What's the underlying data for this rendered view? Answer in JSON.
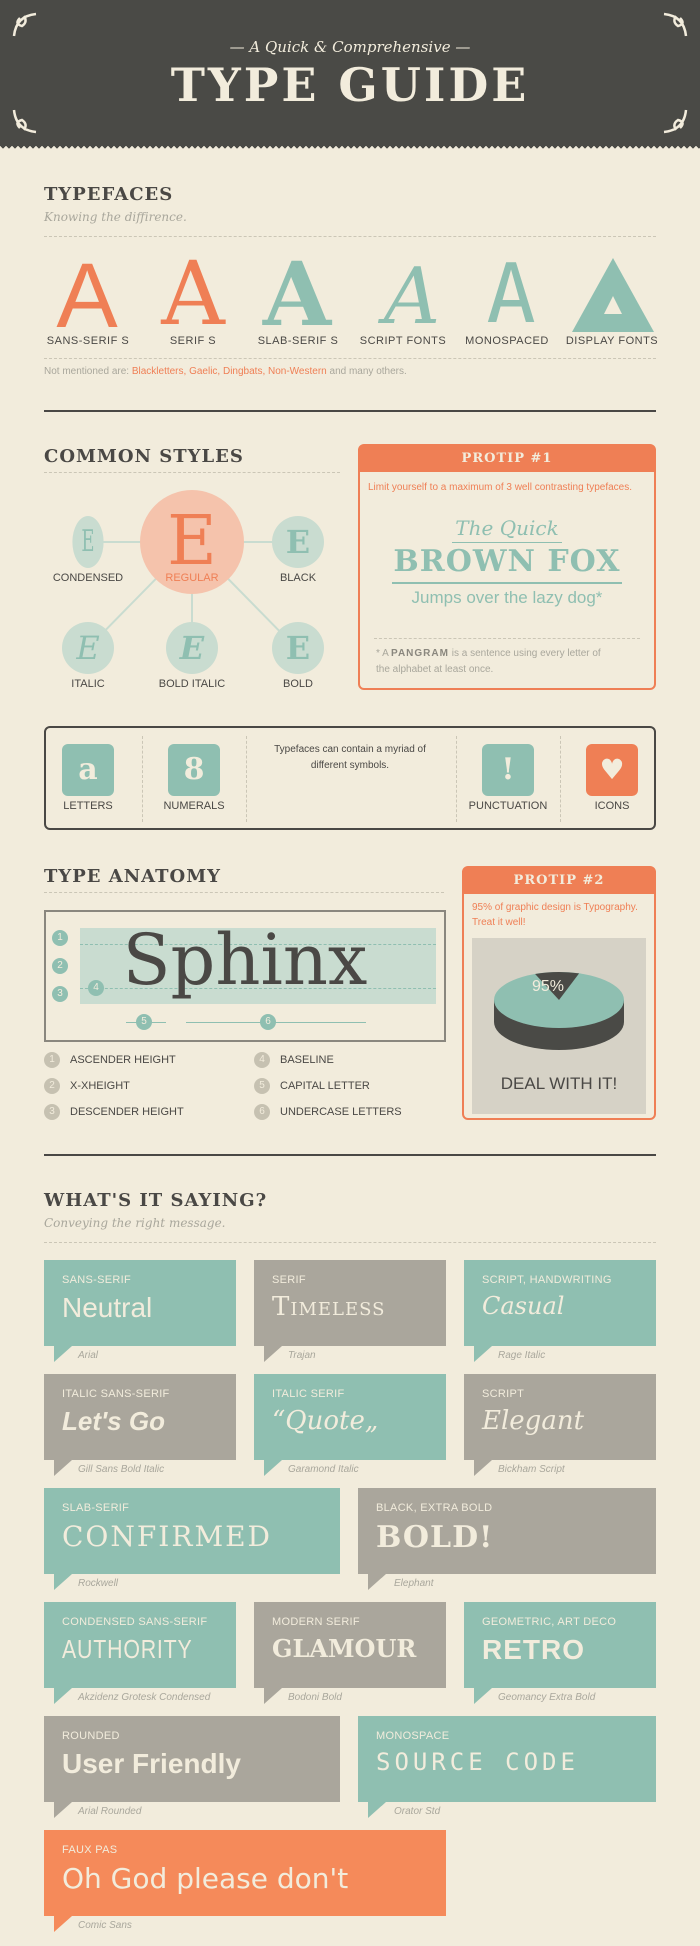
{
  "header": {
    "subtitle": "— A Quick & Comprehensive —",
    "title": "TYPE GUIDE"
  },
  "typefaces": {
    "title": "TYPEFACES",
    "subtitle": "Knowing the diffirence.",
    "items": [
      {
        "glyph": "A",
        "label": "SANS-SERIF S"
      },
      {
        "glyph": "A",
        "label": "SERIF S"
      },
      {
        "glyph": "A",
        "label": "SLAB-SERIF S"
      },
      {
        "glyph": "A",
        "label": "SCRIPT FONTS"
      },
      {
        "glyph": "A",
        "label": "MONOSPACED"
      },
      {
        "glyph": "A",
        "label": "DISPLAY FONTS"
      }
    ],
    "note_prefix": "Not mentioned are: ",
    "note_links": "Blackletters, Gaelic, Dingbats, Non-Western",
    "note_suffix": " and many others."
  },
  "styles": {
    "title": "COMMON STYLES",
    "items": [
      {
        "glyph": "E",
        "label": "CONDENSED"
      },
      {
        "glyph": "E",
        "label": "REGULAR"
      },
      {
        "glyph": "E",
        "label": "BLACK"
      },
      {
        "glyph": "E",
        "label": "ITALIC"
      },
      {
        "glyph": "E",
        "label": "BOLD ITALIC"
      },
      {
        "glyph": "E",
        "label": "BOLD"
      }
    ]
  },
  "protip1": {
    "head": "PROTIP #1",
    "text": "Limit yourself to a maximum of 3 well contrasting typefaces.",
    "line1": "The Quick",
    "line2": "BROWN FOX",
    "line3": "Jumps over the lazy dog*",
    "foot_prefix": "* A ",
    "foot_bold": "PANGRAM",
    "foot_rest": " is a sentence using every letter of",
    "foot_line2": "the alphabet at least once."
  },
  "symbols": {
    "items": [
      {
        "glyph": "a",
        "label": "LETTERS"
      },
      {
        "glyph": "8",
        "label": "NUMERALS"
      },
      {
        "glyph": "!",
        "label": "PUNCTUATION"
      },
      {
        "glyph": "♥",
        "label": "ICONS"
      }
    ],
    "text_line1": "Typefaces can contain a myriad of",
    "text_line2": "different symbols."
  },
  "anatomy": {
    "title": "TYPE ANATOMY",
    "word": "Sphinx",
    "numbers": [
      "1",
      "2",
      "3",
      "4",
      "5",
      "6"
    ],
    "legend": [
      {
        "num": "1",
        "label": "ASCENDER HEIGHT"
      },
      {
        "num": "2",
        "label": "X-XHEIGHT"
      },
      {
        "num": "3",
        "label": "DESCENDER HEIGHT"
      },
      {
        "num": "4",
        "label": "BASELINE"
      },
      {
        "num": "5",
        "label": "CAPITAL LETTER"
      },
      {
        "num": "6",
        "label": "UNDERCASE LETTERS"
      }
    ]
  },
  "protip2": {
    "head": "PROTIP #2",
    "text_line1": "95% of graphic design is Typography.",
    "text_line2": "Treat it well!",
    "pie_percent": "95%",
    "pie_value": 95,
    "caption": "DEAL WITH IT!"
  },
  "saying": {
    "title": "WHAT'S IT SAYING?",
    "subtitle": "Conveying the right message.",
    "bubbles": [
      {
        "cat": "SANS-SERIF",
        "word": "Neutral",
        "font": "Arial"
      },
      {
        "cat": "SERIF",
        "word": "Timeless",
        "font": "Trajan"
      },
      {
        "cat": "SCRIPT, HANDWRITING",
        "word": "Casual",
        "font": "Rage Italic"
      },
      {
        "cat": "ITALIC SANS-SERIF",
        "word": "Let's Go",
        "font": "Gill Sans Bold Italic"
      },
      {
        "cat": "ITALIC SERIF",
        "word": "“Quote„",
        "font": "Garamond Italic"
      },
      {
        "cat": "SCRIPT",
        "word": "Elegant",
        "font": "Bickham Script"
      },
      {
        "cat": "SLAB-SERIF",
        "word": "CONFIRMED",
        "font": "Rockwell"
      },
      {
        "cat": "BLACK, EXTRA BOLD",
        "word": "BOLD!",
        "font": "Elephant"
      },
      {
        "cat": "CONDENSED SANS-SERIF",
        "word": "AUTHORITY",
        "font": "Akzidenz Grotesk Condensed"
      },
      {
        "cat": "MODERN SERIF",
        "word": "GLAMOUR",
        "font": "Bodoni Bold"
      },
      {
        "cat": "GEOMETRIC, ART DECO",
        "word": "RETRO",
        "font": "Geomancy Extra Bold"
      },
      {
        "cat": "ROUNDED",
        "word": "User Friendly",
        "font": "Arial Rounded"
      },
      {
        "cat": "MONOSPACE",
        "word": "SOURCE CODE",
        "font": "Orator Std"
      },
      {
        "cat": "FAUX PAS",
        "word": "Oh God please don't",
        "font": "Comic Sans"
      }
    ]
  },
  "colors": {
    "orange": "#ef7f55",
    "teal": "#8fbfb1",
    "gray": "#aaa69c",
    "dark": "#4a4a46",
    "paper": "#f2ecdc"
  }
}
